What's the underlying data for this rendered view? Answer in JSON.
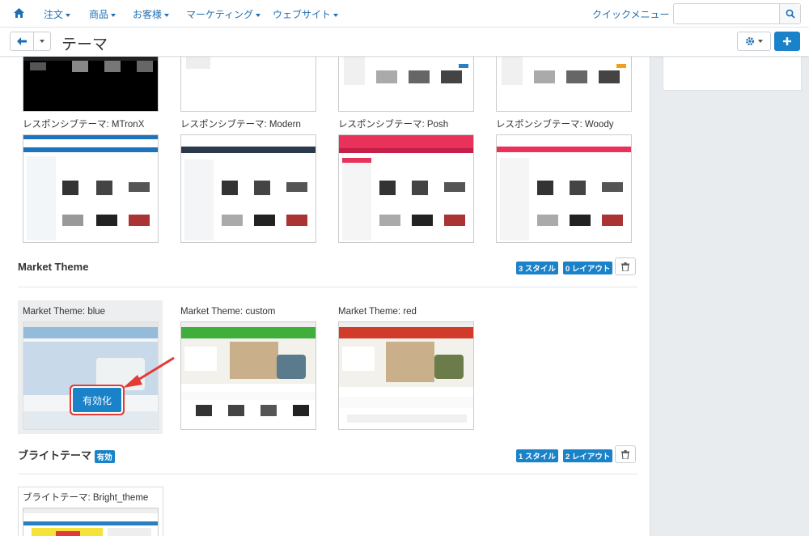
{
  "nav": {
    "items": [
      {
        "label": "注文"
      },
      {
        "label": "商品"
      },
      {
        "label": "お客様"
      },
      {
        "label": "マーケティング"
      },
      {
        "label": "ウェブサイト"
      }
    ],
    "quick_menu": "クイックメニュー",
    "search_placeholder": ""
  },
  "toolbar": {
    "title": "テーマ"
  },
  "responsive_themes": [
    {
      "label": "レスポンシブテーマ: MTronX",
      "accent": "#1e73be"
    },
    {
      "label": "レスポンシブテーマ: Modern",
      "accent": "#2b3a4a"
    },
    {
      "label": "レスポンシブテーマ: Posh",
      "accent": "#e8315b"
    },
    {
      "label": "レスポンシブテーマ: Woody",
      "accent": "#e8315b"
    }
  ],
  "market_section": {
    "title": "Market Theme",
    "styles_badge": "3 スタイル",
    "layouts_badge": "0 レイアウト",
    "themes": [
      {
        "label": "Market Theme: blue",
        "accent": "#2a7fc1"
      },
      {
        "label": "Market Theme: custom",
        "accent": "#3fae3a"
      },
      {
        "label": "Market Theme: red",
        "accent": "#d13b2a"
      }
    ],
    "activate_label": "有効化"
  },
  "bright_section": {
    "title": "ブライトテーマ",
    "active_badge": "有効",
    "styles_badge": "1 スタイル",
    "layouts_badge": "2 レイアウト",
    "themes": [
      {
        "label": "ブライトテーマ: Bright_theme"
      }
    ]
  }
}
